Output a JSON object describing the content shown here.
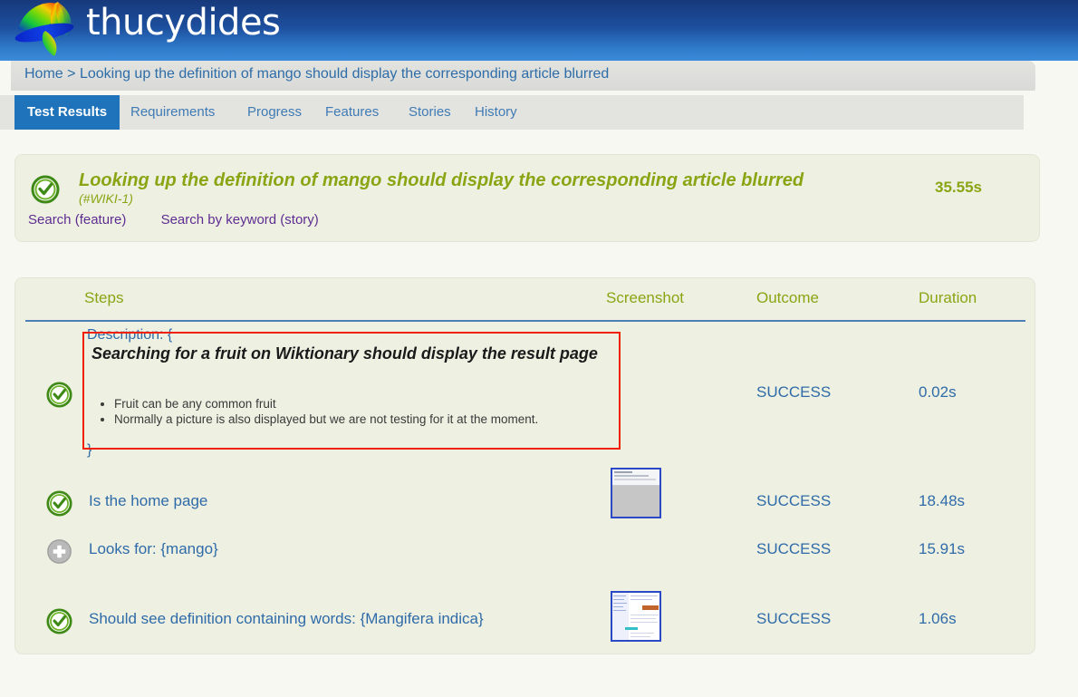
{
  "header": {
    "brand": "thucydides",
    "logo_icon": "thucydides-spiral-logo"
  },
  "breadcrumb": {
    "home_label": "Home",
    "separator": ">",
    "current": "Looking up the definition of mango should display the corresponding article blurred"
  },
  "tabs": [
    {
      "label": "Test Results",
      "active": true
    },
    {
      "label": "Requirements",
      "active": false
    },
    {
      "label": "Progress",
      "active": false
    },
    {
      "label": "Features",
      "active": false
    },
    {
      "label": "Stories",
      "active": false
    },
    {
      "label": "History",
      "active": false
    }
  ],
  "summary": {
    "status_icon": "success-check-icon",
    "title": "Looking up the definition of mango should display the corresponding article blurred",
    "issue_id": "(#WIKI-1)",
    "feature_link": "Search (feature)",
    "story_link": "Search by keyword (story)",
    "duration": "35.55s"
  },
  "steps_table": {
    "columns": {
      "steps": "Steps",
      "screenshot": "Screenshot",
      "outcome": "Outcome",
      "duration": "Duration"
    },
    "description_block": {
      "open_token": "Description: {",
      "close_token": "}",
      "heading": "Searching for a fruit on Wiktionary should display the result page",
      "bullets": [
        "Fruit can be any common fruit",
        "Normally a picture is also displayed but we are not testing for it at the moment."
      ],
      "highlight_color": "#f02100"
    },
    "rows": [
      {
        "icon": "success-check-icon",
        "text": "",
        "outcome": "SUCCESS",
        "duration": "0.02s",
        "thumbnail": null
      },
      {
        "icon": "success-check-icon",
        "text": "Is the home page",
        "outcome": "SUCCESS",
        "duration": "18.48s",
        "thumbnail": "home-page-screenshot"
      },
      {
        "icon": "plus-circle-icon",
        "text": "Looks for: {mango}",
        "outcome": "SUCCESS",
        "duration": "15.91s",
        "thumbnail": null
      },
      {
        "icon": "success-check-icon",
        "text": "Should see definition containing words: {Mangifera indica}",
        "outcome": "SUCCESS",
        "duration": "1.06s",
        "thumbnail": "definition-page-screenshot"
      }
    ]
  },
  "colors": {
    "header_top": "#17397b",
    "header_bottom": "#3c8ad9",
    "accent_olive": "#8aa514",
    "link_blue": "#2f6ba8",
    "tab_active": "#1f73ba",
    "panel_bg": "#eef0e2",
    "page_bg": "#f7f8f2",
    "purple_link": "#5e2d91",
    "thumb_border": "#2b49c4"
  }
}
